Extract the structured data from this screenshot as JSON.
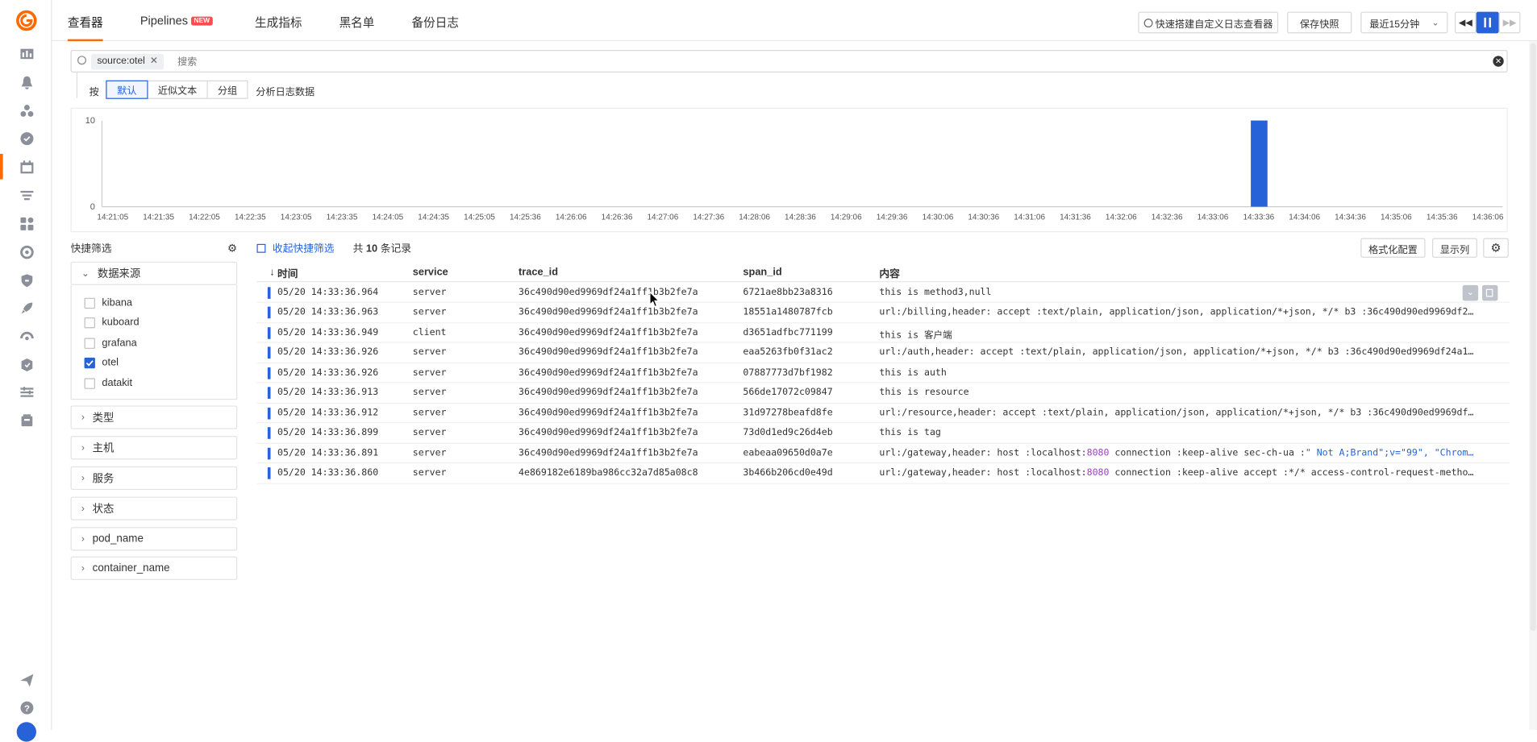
{
  "top_tabs": [
    {
      "label": "查看器"
    },
    {
      "label": "Pipelines",
      "badge": "NEW"
    },
    {
      "label": "生成指标"
    },
    {
      "label": "黑名单"
    },
    {
      "label": "备份日志"
    }
  ],
  "toolbar": {
    "quick_build_label": "快速搭建自定义日志查看器",
    "save_snapshot_label": "保存快照",
    "time_range": "最近15分钟"
  },
  "search": {
    "chip": "source:otel",
    "placeholder": "搜索"
  },
  "analysis": {
    "prefix": "按",
    "options": [
      "默认",
      "近似文本",
      "分组"
    ],
    "selected": "默认",
    "suffix": "分析日志数据"
  },
  "chart_data": {
    "type": "bar",
    "x_ticks": [
      "14:21:05",
      "14:21:35",
      "14:22:05",
      "14:22:35",
      "14:23:05",
      "14:23:35",
      "14:24:05",
      "14:24:35",
      "14:25:05",
      "14:25:36",
      "14:26:06",
      "14:26:36",
      "14:27:06",
      "14:27:36",
      "14:28:06",
      "14:28:36",
      "14:29:06",
      "14:29:36",
      "14:30:06",
      "14:30:36",
      "14:31:06",
      "14:31:36",
      "14:32:06",
      "14:32:36",
      "14:33:06",
      "14:33:36",
      "14:34:06",
      "14:34:36",
      "14:35:06",
      "14:35:36",
      "14:36:06"
    ],
    "y_ticks": [
      "10",
      "0"
    ],
    "ylim": [
      0,
      10
    ],
    "points": [
      {
        "x": "14:33:36",
        "value": 10
      }
    ],
    "color": "#2762d8"
  },
  "quick_filter": {
    "title": "快捷筛选",
    "collapse_label": "收起快捷筛选",
    "data_source": {
      "label": "数据来源",
      "items": [
        {
          "label": "kibana",
          "checked": false
        },
        {
          "label": "kuboard",
          "checked": false
        },
        {
          "label": "grafana",
          "checked": false
        },
        {
          "label": "otel",
          "checked": true
        },
        {
          "label": "datakit",
          "checked": false
        }
      ]
    },
    "facets": [
      "类型",
      "主机",
      "服务",
      "状态",
      "pod_name",
      "container_name"
    ]
  },
  "records": {
    "prefix": "共",
    "count": "10",
    "suffix": "条记录"
  },
  "table_buttons": {
    "format": "格式化配置",
    "columns": "显示列"
  },
  "table": {
    "columns": [
      "时间",
      "service",
      "trace_id",
      "span_id",
      "内容"
    ],
    "rows": [
      {
        "time": "05/20 14:33:36.964",
        "service": "server",
        "trace_id": "36c490d90ed9969df24a1ff1b3b2fe7a",
        "span_id": "6721ae8bb23a8316",
        "content": "this is method3,null"
      },
      {
        "time": "05/20 14:33:36.963",
        "service": "server",
        "trace_id": "36c490d90ed9969df24a1ff1b3b2fe7a",
        "span_id": "18551a1480787fcb",
        "content": "url:/billing,header: accept :text/plain, application/json, application/*+json, */* b3 :36c490d90ed9969df2…"
      },
      {
        "time": "05/20 14:33:36.949",
        "service": "client",
        "trace_id": "36c490d90ed9969df24a1ff1b3b2fe7a",
        "span_id": "d3651adfbc771199",
        "content": "this is 客户端"
      },
      {
        "time": "05/20 14:33:36.926",
        "service": "server",
        "trace_id": "36c490d90ed9969df24a1ff1b3b2fe7a",
        "span_id": "eaa5263fb0f31ac2",
        "content": "url:/auth,header: accept :text/plain, application/json, application/*+json, */* b3 :36c490d90ed9969df24a1…"
      },
      {
        "time": "05/20 14:33:36.926",
        "service": "server",
        "trace_id": "36c490d90ed9969df24a1ff1b3b2fe7a",
        "span_id": "07887773d7bf1982",
        "content": "this is auth"
      },
      {
        "time": "05/20 14:33:36.913",
        "service": "server",
        "trace_id": "36c490d90ed9969df24a1ff1b3b2fe7a",
        "span_id": "566de17072c09847",
        "content": "this is resource"
      },
      {
        "time": "05/20 14:33:36.912",
        "service": "server",
        "trace_id": "36c490d90ed9969df24a1ff1b3b2fe7a",
        "span_id": "31d97278beafd8fe",
        "content": "url:/resource,header: accept :text/plain, application/json, application/*+json, */* b3 :36c490d90ed9969df…"
      },
      {
        "time": "05/20 14:33:36.899",
        "service": "server",
        "trace_id": "36c490d90ed9969df24a1ff1b3b2fe7a",
        "span_id": "73d0d1ed9c26d4eb",
        "content": "this is tag"
      },
      {
        "time": "05/20 14:33:36.891",
        "service": "server",
        "trace_id": "36c490d90ed9969df24a1ff1b3b2fe7a",
        "span_id": "eabeaa09650d0a7e",
        "content_parts": [
          "url:/gateway,header: host :localhost:",
          "8080",
          " connection :keep-alive sec-ch-ua :",
          "\" Not A;Brand\";v=\"99\", \"Chrom…"
        ]
      },
      {
        "time": "05/20 14:33:36.860",
        "service": "server",
        "trace_id": "4e869182e6189ba986cc32a7d85a08c8",
        "span_id": "3b466b206cd0e49d",
        "content_parts": [
          "url:/gateway,header: host :localhost:",
          "8080",
          " connection :keep-alive accept :*/* access-control-request-metho…"
        ]
      }
    ]
  },
  "colors": {
    "accent": "#ff6a00",
    "primary": "#2762d8"
  }
}
